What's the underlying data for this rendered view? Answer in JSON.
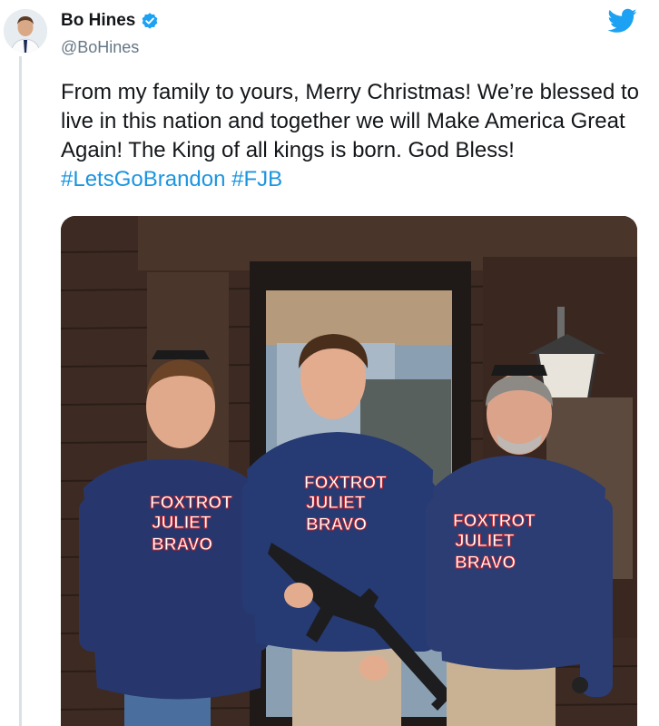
{
  "tweet": {
    "author_name": "Bo Hines",
    "author_handle": "@BoHines",
    "verified": true,
    "text_plain": "From my family to yours, Merry Christmas! We’re blessed to live in this nation and together we will Make America Great Again! The King of all kings is born. God Bless! ",
    "hashtag_1": "#LetsGoBrandon",
    "hashtag_2": "#FJB"
  },
  "media": {
    "sweatshirt_text": [
      "FOXTROT",
      "JULIET",
      "BRAVO"
    ]
  },
  "colors": {
    "brand": "#1da1f2",
    "hashtag": "#1b95e0",
    "text": "#14171a",
    "secondary": "#657786"
  },
  "icons": {
    "logo": "twitter-bird-icon",
    "verified": "verified-badge-icon"
  }
}
